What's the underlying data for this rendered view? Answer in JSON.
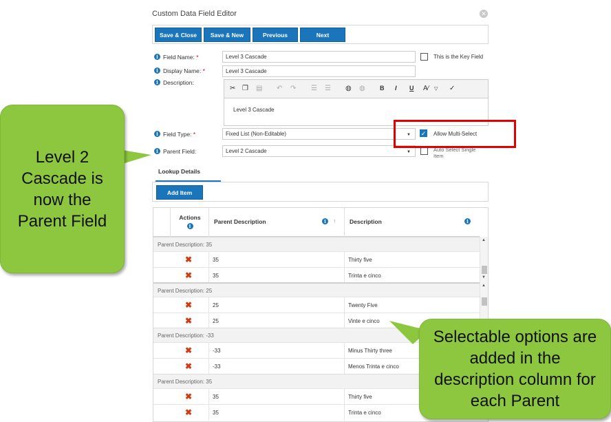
{
  "dialog": {
    "title": "Custom Data Field Editor",
    "close_glyph": "✕"
  },
  "toolbar": {
    "save_close": "Save & Close",
    "save_new": "Save & New",
    "previous": "Previous",
    "next": "Next"
  },
  "form": {
    "field_name_label": "Field Name:",
    "field_name_value": "Level 3 Cascade",
    "key_field_label": "This is the Key Field",
    "display_name_label": "Display Name:",
    "display_name_value": "Level 3 Cascade",
    "description_label": "Description:",
    "description_value": "Level 3 Cascade",
    "field_type_label": "Field Type:",
    "field_type_value": "Fixed List (Non-Editable)",
    "allow_multi_label": "Allow Multi-Select",
    "parent_field_label": "Parent Field:",
    "parent_field_value": "Level 2 Cascade",
    "hidden_option_label": "Auto Select Single",
    "hidden_option_label2": "Item",
    "required_mark": "*"
  },
  "editor_toolbar": {
    "underline": "U",
    "bold": "B",
    "italic": "I"
  },
  "tabs": {
    "lookup_details": "Lookup Details"
  },
  "actions": {
    "add_item": "Add Item"
  },
  "grid": {
    "columns": {
      "actions": "Actions",
      "parent_description": "Parent Description",
      "description": "Description"
    },
    "groups": [
      {
        "label": "Parent Description: 35",
        "rows": [
          {
            "parent": "35",
            "description": "Thirty five"
          },
          {
            "parent": "35",
            "description": "Trinta e cinco"
          }
        ]
      },
      {
        "label": "Parent Description: 25",
        "rows": [
          {
            "parent": "25",
            "description": "Twenty Five"
          },
          {
            "parent": "25",
            "description": "Vinte e cinco"
          }
        ]
      },
      {
        "label": "Parent Description: -33",
        "rows": [
          {
            "parent": "-33",
            "description": "Minus Thirty three"
          },
          {
            "parent": "-33",
            "description": "Menos Trinta e cinco"
          }
        ]
      },
      {
        "label": "Parent Description: 35",
        "rows": [
          {
            "parent": "35",
            "description": "Thirty five"
          },
          {
            "parent": "35",
            "description": "Trinta e cinco"
          }
        ]
      }
    ]
  },
  "callouts": {
    "left": "Level 2 Cascade is now the Parent Field",
    "right": "Selectable options are added in the description column for each Parent"
  },
  "colors": {
    "primary_button": "#1b75bb",
    "callout_green": "#8dc63f",
    "highlight_red": "#e00000",
    "delete_icon": "#d03b12"
  }
}
